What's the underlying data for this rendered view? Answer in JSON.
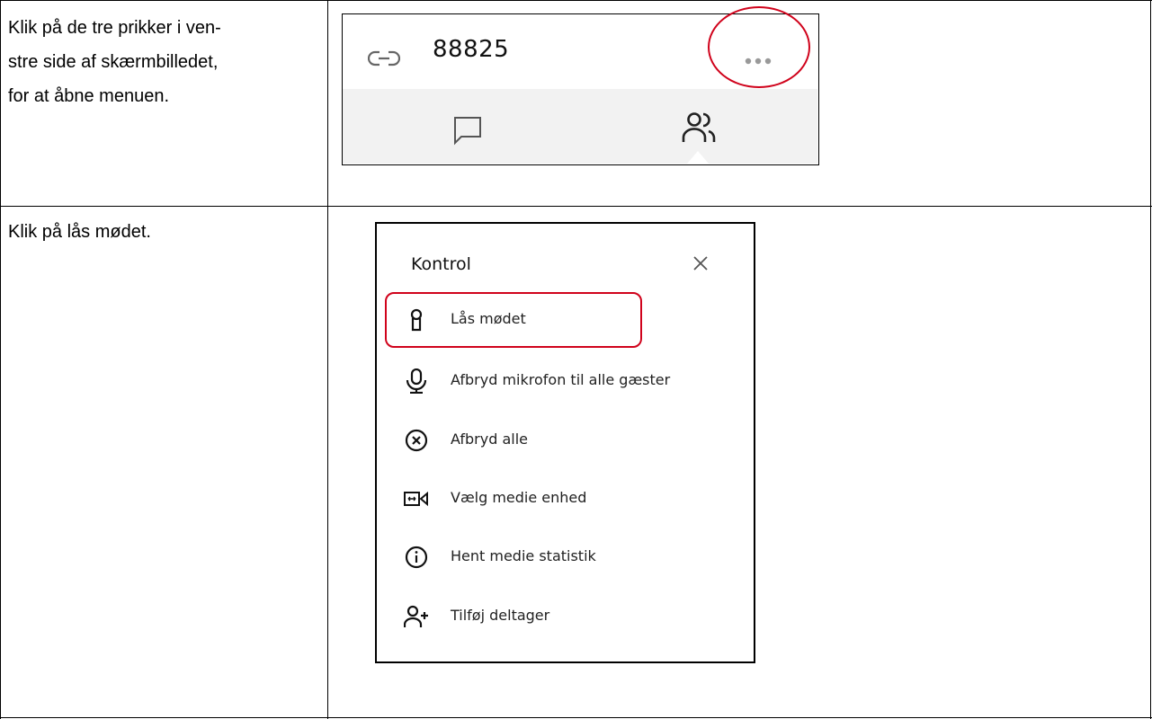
{
  "rows": [
    {
      "instruction_lines": [
        "Klik på de tre prikker i ven-",
        "stre side af skærmbilledet,",
        "for at åbne menuen."
      ]
    },
    {
      "instruction_lines": [
        "Klik på lås mødet."
      ]
    }
  ],
  "screenshot1": {
    "meeting_id": "88825",
    "icons": [
      "link-icon",
      "more-dots-icon",
      "chat-icon",
      "participants-icon"
    ],
    "highlight_color": "#d0021b"
  },
  "screenshot2": {
    "panel_title": "Kontrol",
    "menu_items": [
      {
        "label": "Lås mødet",
        "icon": "lock-icon"
      },
      {
        "label": "Afbryd mikrofon til alle gæster",
        "icon": "microphone-icon"
      },
      {
        "label": "Afbryd alle",
        "icon": "x-circle-icon"
      },
      {
        "label": "Vælg medie enhed",
        "icon": "media-device-icon"
      },
      {
        "label": "Hent medie statistik",
        "icon": "info-icon"
      },
      {
        "label": "Tilføj deltager",
        "icon": "add-person-icon"
      }
    ],
    "highlight_color": "#d0021b"
  }
}
